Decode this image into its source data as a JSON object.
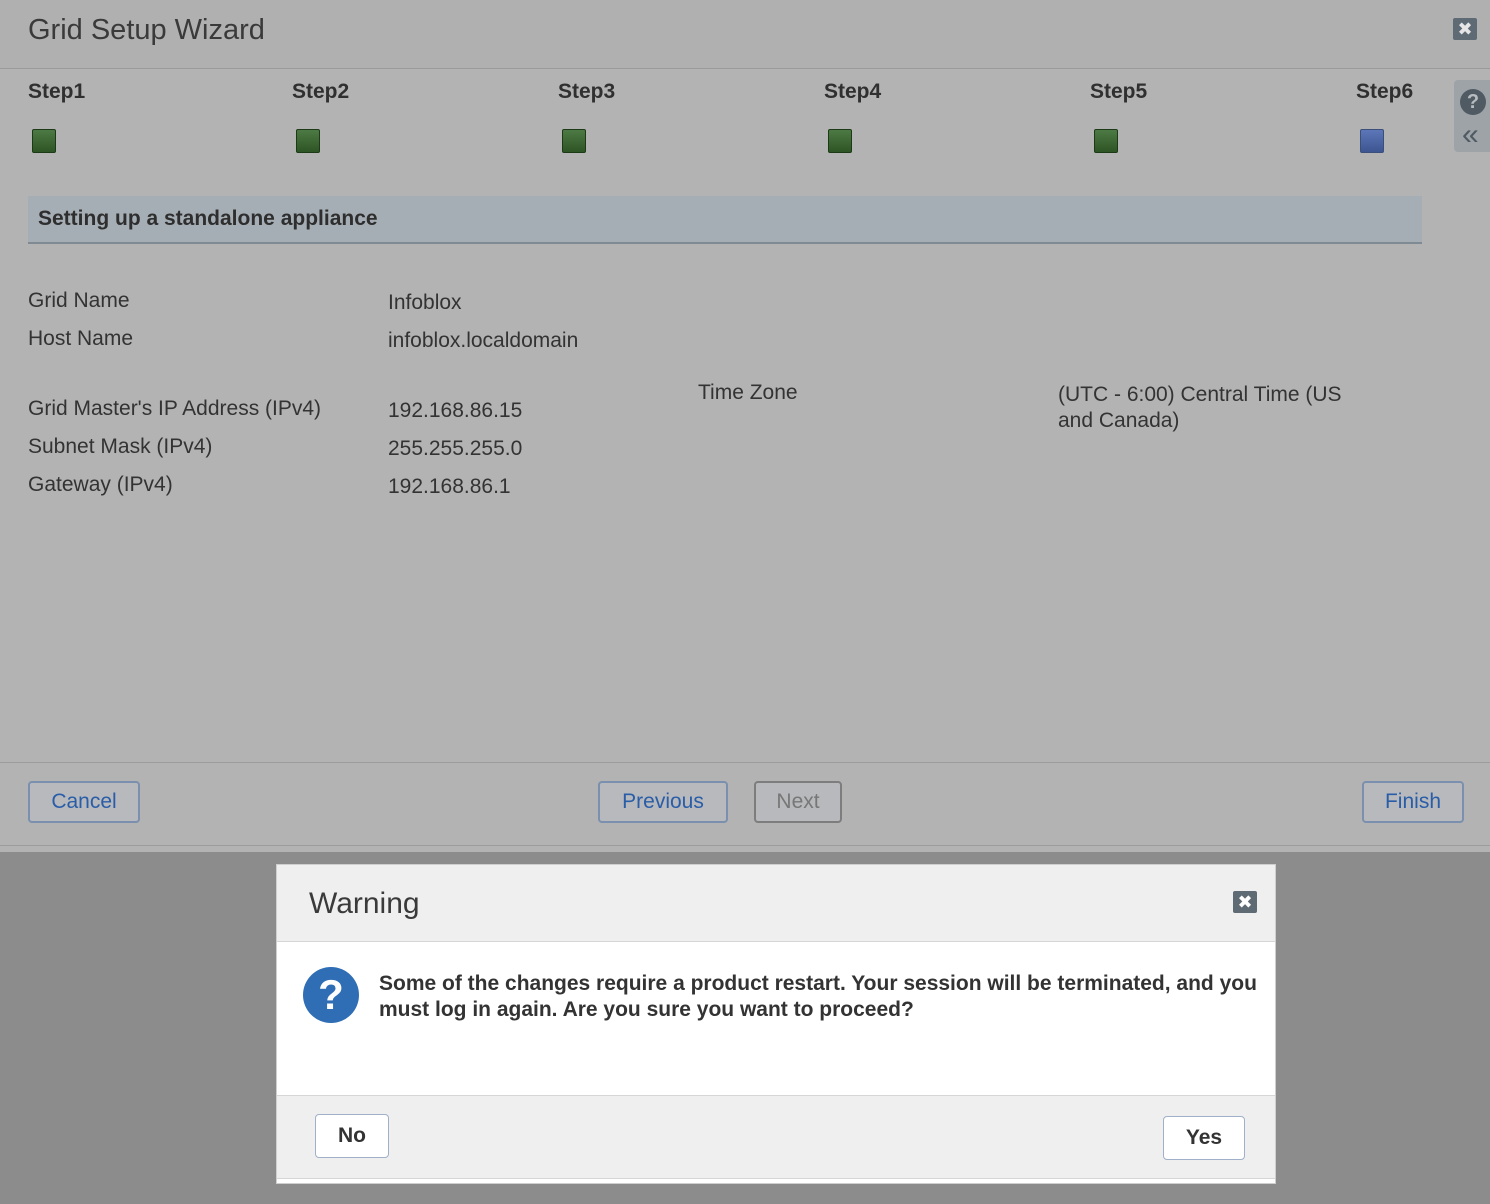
{
  "wizard": {
    "title": "Grid Setup Wizard",
    "close_glyph": "✖",
    "help_glyph": "?",
    "collapse_glyph": "«",
    "steps": [
      {
        "label": "Step1",
        "state": "complete"
      },
      {
        "label": "Step2",
        "state": "complete"
      },
      {
        "label": "Step3",
        "state": "complete"
      },
      {
        "label": "Step4",
        "state": "complete"
      },
      {
        "label": "Step5",
        "state": "complete"
      },
      {
        "label": "Step6",
        "state": "current"
      }
    ],
    "section_title": "Setting up a standalone appliance",
    "fields": {
      "grid_name_label": "Grid Name",
      "grid_name_value": "Infoblox",
      "host_name_label": "Host Name",
      "host_name_value": "infoblox.localdomain",
      "ip_label": "Grid Master's IP Address (IPv4)",
      "ip_value": "192.168.86.15",
      "subnet_label": "Subnet Mask (IPv4)",
      "subnet_value": "255.255.255.0",
      "gateway_label": "Gateway (IPv4)",
      "gateway_value": "192.168.86.1",
      "timezone_label": "Time Zone",
      "timezone_value": "(UTC - 6:00) Central Time (US and Canada)"
    },
    "buttons": {
      "cancel": "Cancel",
      "previous": "Previous",
      "next": "Next",
      "finish": "Finish"
    }
  },
  "dialog": {
    "title": "Warning",
    "close_glyph": "✖",
    "question_glyph": "?",
    "message": "Some of the changes require a product restart. Your session will be terminated, and you must log in again. Are you sure you want to proceed?",
    "no_label": "No",
    "yes_label": "Yes"
  },
  "colors": {
    "step_complete": "#3d6a34",
    "step_current": "#4b64a3",
    "link_blue": "#2a5da8",
    "question_blue": "#2f6eb5"
  }
}
